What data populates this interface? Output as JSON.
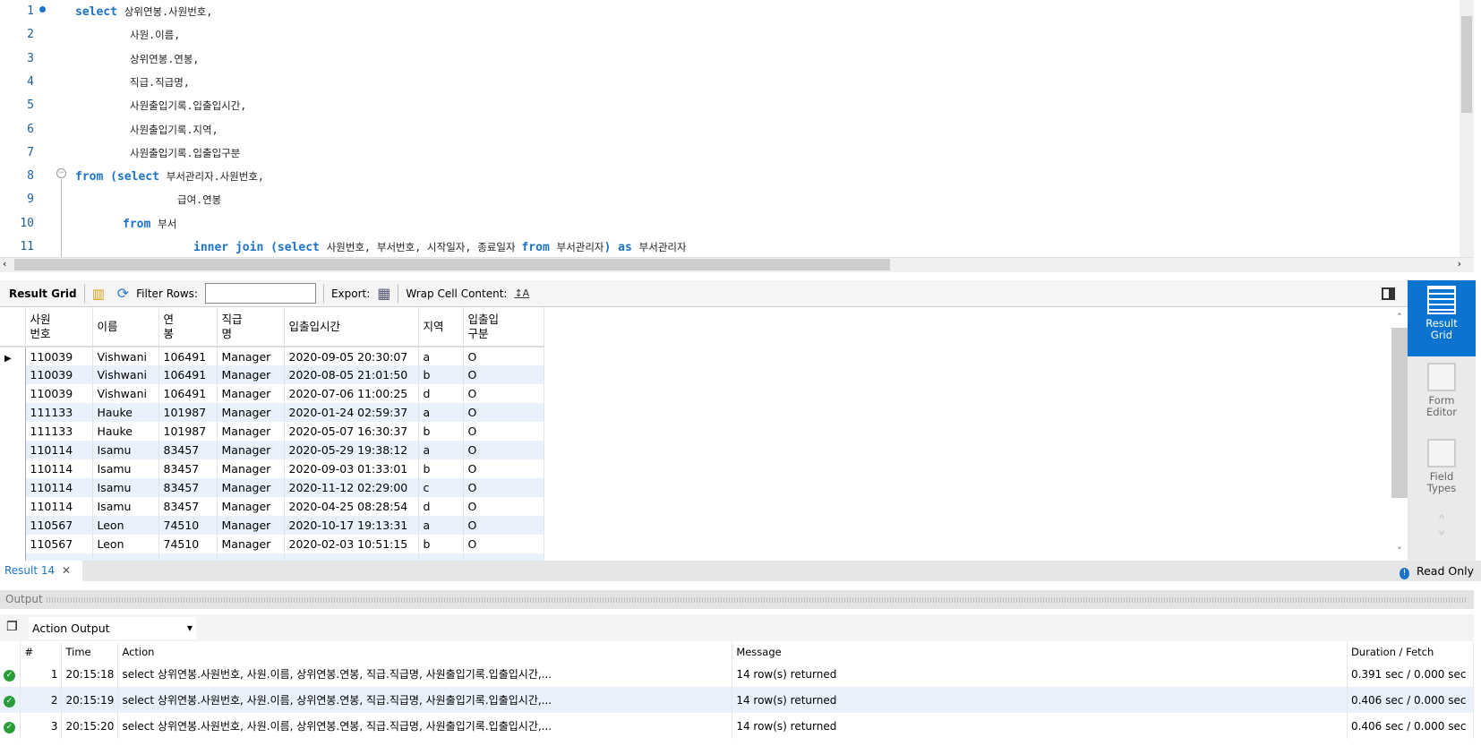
{
  "editor": {
    "lines": [
      {
        "n": "1",
        "indent": 84,
        "tokens": [
          {
            "k": "kw",
            "t": "select "
          },
          {
            "k": "tx",
            "t": "상위연봉.사원번호,"
          }
        ]
      },
      {
        "n": "2",
        "indent": 145,
        "tokens": [
          {
            "k": "tx",
            "t": "사원.이름,"
          }
        ]
      },
      {
        "n": "3",
        "indent": 145,
        "tokens": [
          {
            "k": "tx",
            "t": "상위연봉.연봉,"
          }
        ]
      },
      {
        "n": "4",
        "indent": 145,
        "tokens": [
          {
            "k": "tx",
            "t": "직급.직급명,"
          }
        ]
      },
      {
        "n": "5",
        "indent": 145,
        "tokens": [
          {
            "k": "tx",
            "t": "사원출입기록.입출입시간,"
          }
        ]
      },
      {
        "n": "6",
        "indent": 145,
        "tokens": [
          {
            "k": "tx",
            "t": "사원출입기록.지역,"
          }
        ]
      },
      {
        "n": "7",
        "indent": 145,
        "tokens": [
          {
            "k": "tx",
            "t": "사원출입기록.입출입구분"
          }
        ]
      },
      {
        "n": "8",
        "indent": 84,
        "tokens": [
          {
            "k": "kw",
            "t": "from ("
          },
          {
            "k": "kw",
            "t": "select "
          },
          {
            "k": "tx",
            "t": "부서관리자.사원번호,"
          }
        ]
      },
      {
        "n": "9",
        "indent": 198,
        "tokens": [
          {
            "k": "tx",
            "t": "급여.연봉"
          }
        ]
      },
      {
        "n": "10",
        "indent": 137,
        "tokens": [
          {
            "k": "kw",
            "t": "from "
          },
          {
            "k": "tx",
            "t": "부서"
          }
        ]
      },
      {
        "n": "11",
        "indent": 216,
        "tokens": [
          {
            "k": "kw",
            "t": "inner join ("
          },
          {
            "k": "kw",
            "t": "select "
          },
          {
            "k": "tx",
            "t": "사원번호, 부서번호, 시작일자, 종료일자 "
          },
          {
            "k": "kw",
            "t": "from "
          },
          {
            "k": "tx",
            "t": "부서관리자"
          },
          {
            "k": "kw",
            "t": ") as "
          },
          {
            "k": "tx",
            "t": "부서관리자"
          }
        ]
      }
    ]
  },
  "toolbar": {
    "result_grid": "Result Grid",
    "filter_rows": "Filter Rows:",
    "filter_value": "",
    "export": "Export:",
    "wrap": "Wrap Cell Content:"
  },
  "grid": {
    "columns": [
      "사원\n번호",
      "이름",
      "연\n봉",
      "직급\n명",
      "입출입시간",
      "지역",
      "입출입\n구분"
    ],
    "rows": [
      [
        "110039",
        "Vishwani",
        "106491",
        "Manager",
        "2020-09-05 20:30:07",
        "a",
        "O"
      ],
      [
        "110039",
        "Vishwani",
        "106491",
        "Manager",
        "2020-08-05 21:01:50",
        "b",
        "O"
      ],
      [
        "110039",
        "Vishwani",
        "106491",
        "Manager",
        "2020-07-06 11:00:25",
        "d",
        "O"
      ],
      [
        "111133",
        "Hauke",
        "101987",
        "Manager",
        "2020-01-24 02:59:37",
        "a",
        "O"
      ],
      [
        "111133",
        "Hauke",
        "101987",
        "Manager",
        "2020-05-07 16:30:37",
        "b",
        "O"
      ],
      [
        "110114",
        "Isamu",
        "83457",
        "Manager",
        "2020-05-29 19:38:12",
        "a",
        "O"
      ],
      [
        "110114",
        "Isamu",
        "83457",
        "Manager",
        "2020-09-03 01:33:01",
        "b",
        "O"
      ],
      [
        "110114",
        "Isamu",
        "83457",
        "Manager",
        "2020-11-12 02:29:00",
        "c",
        "O"
      ],
      [
        "110114",
        "Isamu",
        "83457",
        "Manager",
        "2020-04-25 08:28:54",
        "d",
        "O"
      ],
      [
        "110567",
        "Leon",
        "74510",
        "Manager",
        "2020-10-17 19:13:31",
        "a",
        "O"
      ],
      [
        "110567",
        "Leon",
        "74510",
        "Manager",
        "2020-02-03 10:51:15",
        "b",
        "O"
      ]
    ]
  },
  "side": {
    "result_grid": "Result\nGrid",
    "form_editor": "Form\nEditor",
    "field_types": "Field\nTypes"
  },
  "result_tab": {
    "label": "Result 14",
    "read_only": "Read Only"
  },
  "output": {
    "title": "Output",
    "dropdown": "Action Output",
    "headers": [
      "#",
      "Time",
      "Action",
      "Message",
      "Duration / Fetch"
    ],
    "rows": [
      [
        "1",
        "20:15:18",
        "select 상위연봉.사원번호,        사원.이름,        상위연봉.연봉,        직급.직급명,        사원출입기록.입출입시간,...",
        "14 row(s) returned",
        "0.391 sec / 0.000 sec"
      ],
      [
        "2",
        "20:15:19",
        "select 상위연봉.사원번호,        사원.이름,        상위연봉.연봉,        직급.직급명,        사원출입기록.입출입시간,...",
        "14 row(s) returned",
        "0.406 sec / 0.000 sec"
      ],
      [
        "3",
        "20:15:20",
        "select 상위연봉.사원번호,        사원.이름,        상위연봉.연봉,        직급.직급명,        사원출입기록.입출입시간,...",
        "14 row(s) returned",
        "0.406 sec / 0.000 sec"
      ]
    ]
  },
  "colors": {
    "accent": "#0a74d0",
    "keyword": "#1a73c8",
    "row_alt": "#e9f1fd",
    "success": "#2a9d3a"
  }
}
